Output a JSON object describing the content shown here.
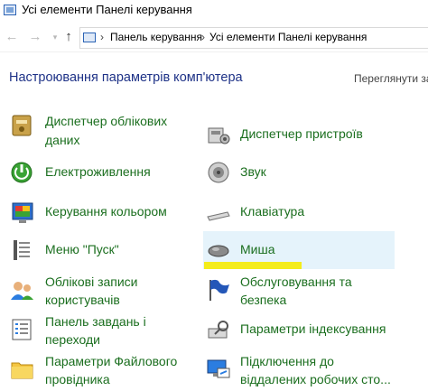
{
  "window": {
    "title": "Усі елементи Панелі керування",
    "icon": "control-panel-icon"
  },
  "nav": {
    "back_icon": "arrow-left-icon",
    "forward_icon": "arrow-right-icon",
    "recent_icon": "chevron-down-icon",
    "up_icon": "arrow-up-icon",
    "breadcrumb": [
      "Панель керування",
      "Усі елементи Панелі керування"
    ],
    "separator": "›"
  },
  "main": {
    "heading": "Настроювання параметрів комп'ютера",
    "view_by_label": "Переглянути за"
  },
  "items": [
    {
      "id": "device-manager",
      "lines": [
        "Диспетчер облікових",
        "даних"
      ],
      "icon": "credential-manager-icon"
    },
    {
      "id": "devices-printers",
      "lines": [
        "Диспетчер пристроїв"
      ],
      "icon": "device-manager-icon"
    },
    {
      "id": "power",
      "lines": [
        "Електроживлення"
      ],
      "icon": "power-options-icon"
    },
    {
      "id": "sound",
      "lines": [
        "Звук"
      ],
      "icon": "speaker-icon"
    },
    {
      "id": "color",
      "lines": [
        "Керування кольором"
      ],
      "icon": "color-management-icon"
    },
    {
      "id": "keyboard",
      "lines": [
        "Клавіатура"
      ],
      "icon": "keyboard-icon"
    },
    {
      "id": "start-menu",
      "lines": [
        "Меню \"Пуск\""
      ],
      "icon": "start-menu-icon"
    },
    {
      "id": "mouse",
      "lines": [
        "Миша"
      ],
      "icon": "mouse-icon"
    },
    {
      "id": "user-accounts",
      "lines": [
        "Облікові записи",
        "користувачів"
      ],
      "icon": "user-accounts-icon"
    },
    {
      "id": "security-maintenance",
      "lines": [
        "Обслуговування та",
        "безпека"
      ],
      "icon": "flag-icon"
    },
    {
      "id": "taskbar",
      "lines": [
        "Панель завдань і",
        "переходи"
      ],
      "icon": "taskbar-icon"
    },
    {
      "id": "indexing",
      "lines": [
        "Параметри індексування"
      ],
      "icon": "indexing-icon"
    },
    {
      "id": "explorer-options",
      "lines": [
        "Параметри Файлового",
        "провідника"
      ],
      "icon": "folder-options-icon"
    },
    {
      "id": "remote-connections",
      "lines": [
        "Підключення до",
        "віддалених робочих сто..."
      ],
      "icon": "remote-desktop-icon"
    }
  ],
  "colors": {
    "heading": "#1e3287",
    "item_label": "#1a6e1e",
    "hover_background": "#e5f3fb",
    "highlighter": "#f4ec1a"
  }
}
